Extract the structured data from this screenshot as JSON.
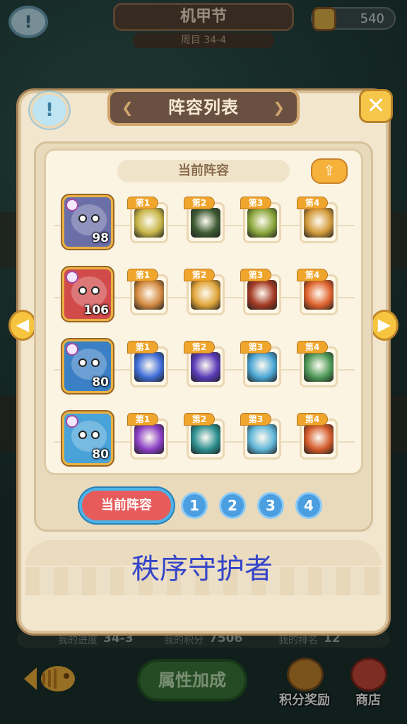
{
  "header": {
    "title": "机甲节",
    "subtitle": "周目 34-4",
    "currency_value": "540"
  },
  "dialog": {
    "title": "阵容列表",
    "current_label": "当前阵容",
    "team_name": "秩序守护者"
  },
  "team": [
    {
      "level": "98",
      "color": "#6b6fa8",
      "skills": [
        {
          "tag": "第1",
          "color": "#c7b548"
        },
        {
          "tag": "第2",
          "color": "#3d5a33"
        },
        {
          "tag": "第3",
          "color": "#8aa63a"
        },
        {
          "tag": "第4",
          "color": "#d29a3a"
        }
      ]
    },
    {
      "level": "106",
      "color": "#d24b4b",
      "skills": [
        {
          "tag": "第1",
          "color": "#d48a40"
        },
        {
          "tag": "第2",
          "color": "#e0a53a"
        },
        {
          "tag": "第3",
          "color": "#a33a24"
        },
        {
          "tag": "第4",
          "color": "#e0622d"
        }
      ]
    },
    {
      "level": "80",
      "color": "#3b7fc4",
      "skills": [
        {
          "tag": "第1",
          "color": "#3f6ed8"
        },
        {
          "tag": "第2",
          "color": "#5a3bb8"
        },
        {
          "tag": "第3",
          "color": "#4aa6d4"
        },
        {
          "tag": "第4",
          "color": "#4e9a58"
        }
      ]
    },
    {
      "level": "80",
      "color": "#4aa3d8",
      "skills": [
        {
          "tag": "第1",
          "color": "#8a3fc4"
        },
        {
          "tag": "第2",
          "color": "#2b8f8f"
        },
        {
          "tag": "第3",
          "color": "#5fb6d8"
        },
        {
          "tag": "第4",
          "color": "#d25a2a"
        }
      ]
    }
  ],
  "tabs": {
    "current": "当前阵容",
    "numbers": [
      "1",
      "2",
      "3",
      "4"
    ]
  },
  "bottom": {
    "progress_label": "我的进度",
    "progress_value": "34-3",
    "points_label": "我的积分",
    "points_value": "7506",
    "rank_label": "我的排名",
    "rank_value": "12",
    "attr_button": "属性加成",
    "reward_button": "积分奖励",
    "shop_button": "商店"
  },
  "colors": {
    "accent_orange": "#f0a62d",
    "tab_active": "#e85b5b",
    "tab_number": "#4b9ee0",
    "team_name": "#3445c8"
  }
}
